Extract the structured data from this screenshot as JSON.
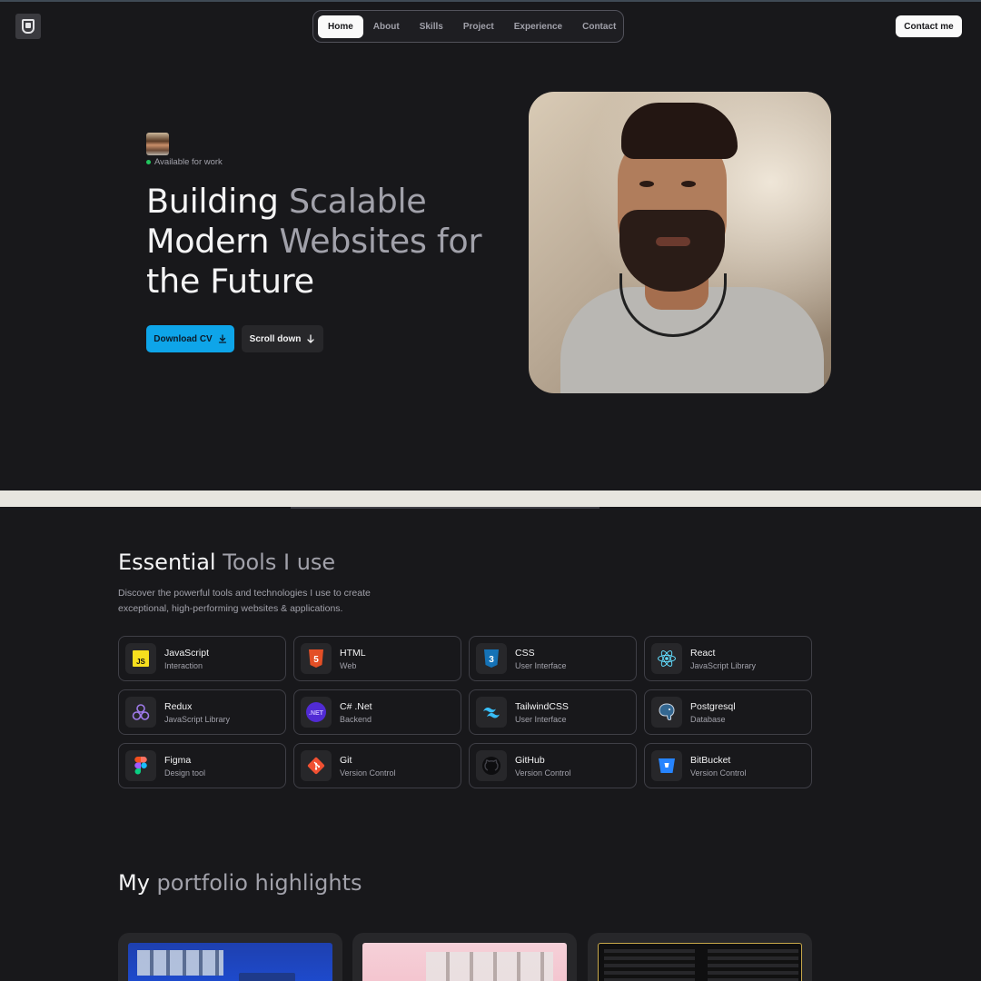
{
  "nav": {
    "items": [
      "Home",
      "About",
      "Skills",
      "Project",
      "Experience",
      "Contact"
    ],
    "active": "Home"
  },
  "header": {
    "contact_label": "Contact me"
  },
  "hero": {
    "status": "Available for work",
    "headline": {
      "line1_a": "Building ",
      "line1_b": "Scalable",
      "line2_a": "Modern ",
      "line2_b": "Websites for",
      "line3": "the Future"
    },
    "download_label": "Download CV",
    "scroll_label": "Scroll down"
  },
  "tools": {
    "title_a": "Essential ",
    "title_b": "Tools I use",
    "description": "Discover the powerful tools and technologies I use to create exceptional, high-performing websites & applications.",
    "items": [
      {
        "name": "JavaScript",
        "sub": "Interaction",
        "icon": "javascript-icon"
      },
      {
        "name": "HTML",
        "sub": "Web",
        "icon": "html-icon"
      },
      {
        "name": "CSS",
        "sub": "User Interface",
        "icon": "css-icon"
      },
      {
        "name": "React",
        "sub": "JavaScript Library",
        "icon": "react-icon"
      },
      {
        "name": "Redux",
        "sub": "JavaScript Library",
        "icon": "redux-icon"
      },
      {
        "name": "C# .Net",
        "sub": "Backend",
        "icon": "dotnet-icon"
      },
      {
        "name": "TailwindCSS",
        "sub": "User Interface",
        "icon": "tailwind-icon"
      },
      {
        "name": "Postgresql",
        "sub": "Database",
        "icon": "postgresql-icon"
      },
      {
        "name": "Figma",
        "sub": "Design tool",
        "icon": "figma-icon"
      },
      {
        "name": "Git",
        "sub": "Version Control",
        "icon": "git-icon"
      },
      {
        "name": "GitHub",
        "sub": "Version Control",
        "icon": "github-icon"
      },
      {
        "name": "BitBucket",
        "sub": "Version Control",
        "icon": "bitbucket-icon"
      }
    ]
  },
  "portfolio": {
    "title_a": "My ",
    "title_b": "portfolio highlights"
  },
  "colors": {
    "accent": "#0ea5e9",
    "background": "#18181b",
    "status": "#22c55e"
  }
}
